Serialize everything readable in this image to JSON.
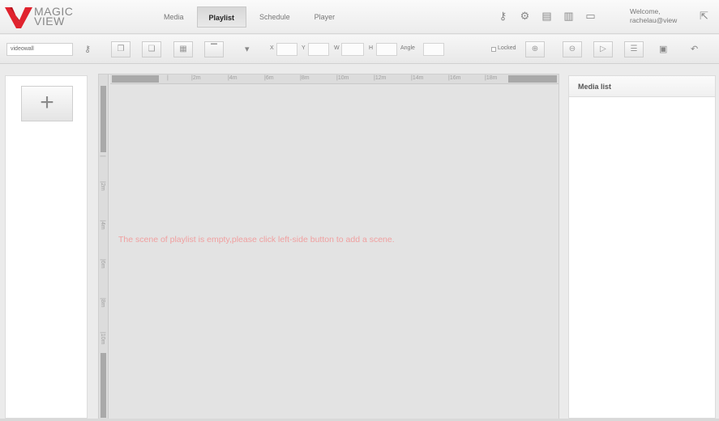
{
  "app": {
    "logo_line1": "MAGIC",
    "logo_line2": "VIEW",
    "brand_color": "#e0232e"
  },
  "nav": {
    "tabs": [
      {
        "label": "Media",
        "active": false
      },
      {
        "label": "Playlist",
        "active": true
      },
      {
        "label": "Schedule",
        "active": false
      },
      {
        "label": "Player",
        "active": false
      }
    ]
  },
  "header": {
    "icons": [
      "key-icon",
      "settings-icon",
      "clipboard-icon",
      "bar-chart-icon",
      "monitor-icon"
    ],
    "welcome_line1": "Welcome,",
    "welcome_line2": "rachelau@view",
    "logout_icon": "logout-icon"
  },
  "toolbar": {
    "resolution_value": "videowall",
    "x_label": "X",
    "y_label": "Y",
    "w_label": "W",
    "h_label": "H",
    "angle_label": "Angle",
    "locked_label": "Locked"
  },
  "left_panel": {
    "add_scene_symbol": "+"
  },
  "canvas": {
    "h_ticks": [
      "|",
      "|2m",
      "|4m",
      "|6m",
      "|8m",
      "|10m",
      "|12m",
      "|14m",
      "|16m",
      "|18m"
    ],
    "v_ticks": [
      "|",
      "|2m",
      "|4m",
      "|6m",
      "|8m",
      "|10m"
    ],
    "empty_message": "The scene of playlist is empty,please click left-side button to add a scene."
  },
  "right_panel": {
    "title": "Media list"
  }
}
